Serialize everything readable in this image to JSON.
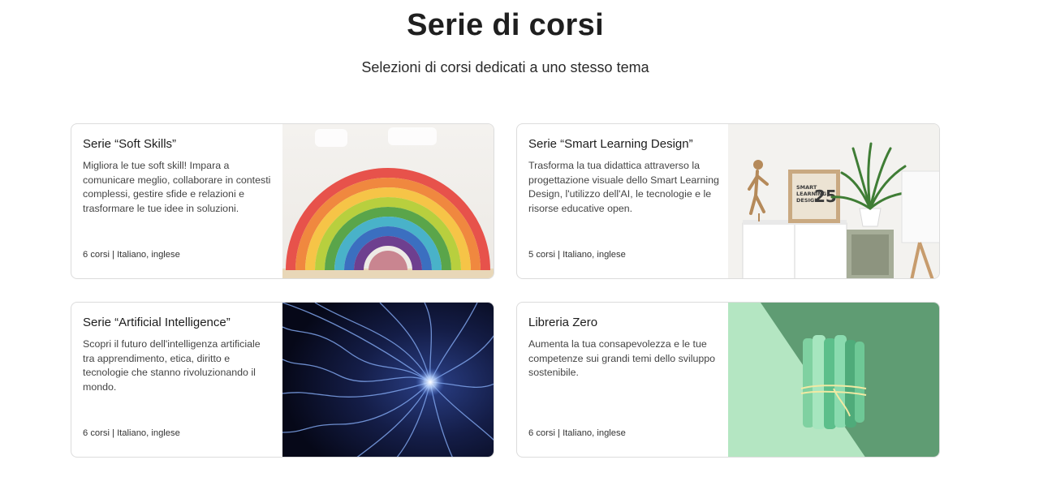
{
  "header": {
    "title": "Serie di corsi",
    "subtitle": "Selezioni di corsi dedicati a uno stesso tema"
  },
  "cards": [
    {
      "title": "Serie “Soft Skills”",
      "description": "Migliora le tue soft skill! Impara a comunicare meglio, collaborare in contesti complessi, gestire sfide e relazioni e trasformare le tue idee in soluzioni.",
      "meta": "6 corsi | Italiano, inglese",
      "image": "rainbow-blocks-image"
    },
    {
      "title": "Serie “Smart Learning Design”",
      "description": "Trasforma la tua didattica attraverso la progettazione visuale dello Smart Learning Design, l'utilizzo dell'AI, le tecnologie e le risorse educative open.",
      "meta": "5 corsi | Italiano, inglese",
      "image": "shelf-with-plant-image",
      "image_text": {
        "line1": "SMART",
        "line2": "LEARNING",
        "line3": "DESIGN",
        "number": "25"
      }
    },
    {
      "title": "Serie “Artificial Intelligence”",
      "description": "Scopri il futuro dell'intelligenza artificiale tra apprendimento, etica, diritto e tecnologie che stanno rivoluzionando il mondo.",
      "meta": "6 corsi | Italiano, inglese",
      "image": "neural-waves-image"
    },
    {
      "title": "Libreria Zero",
      "description": "Aumenta la tua consapevolezza e le tue competenze sui grandi temi dello sviluppo sostenibile.",
      "meta": "6 corsi | Italiano, inglese",
      "image": "green-rolls-image"
    }
  ]
}
